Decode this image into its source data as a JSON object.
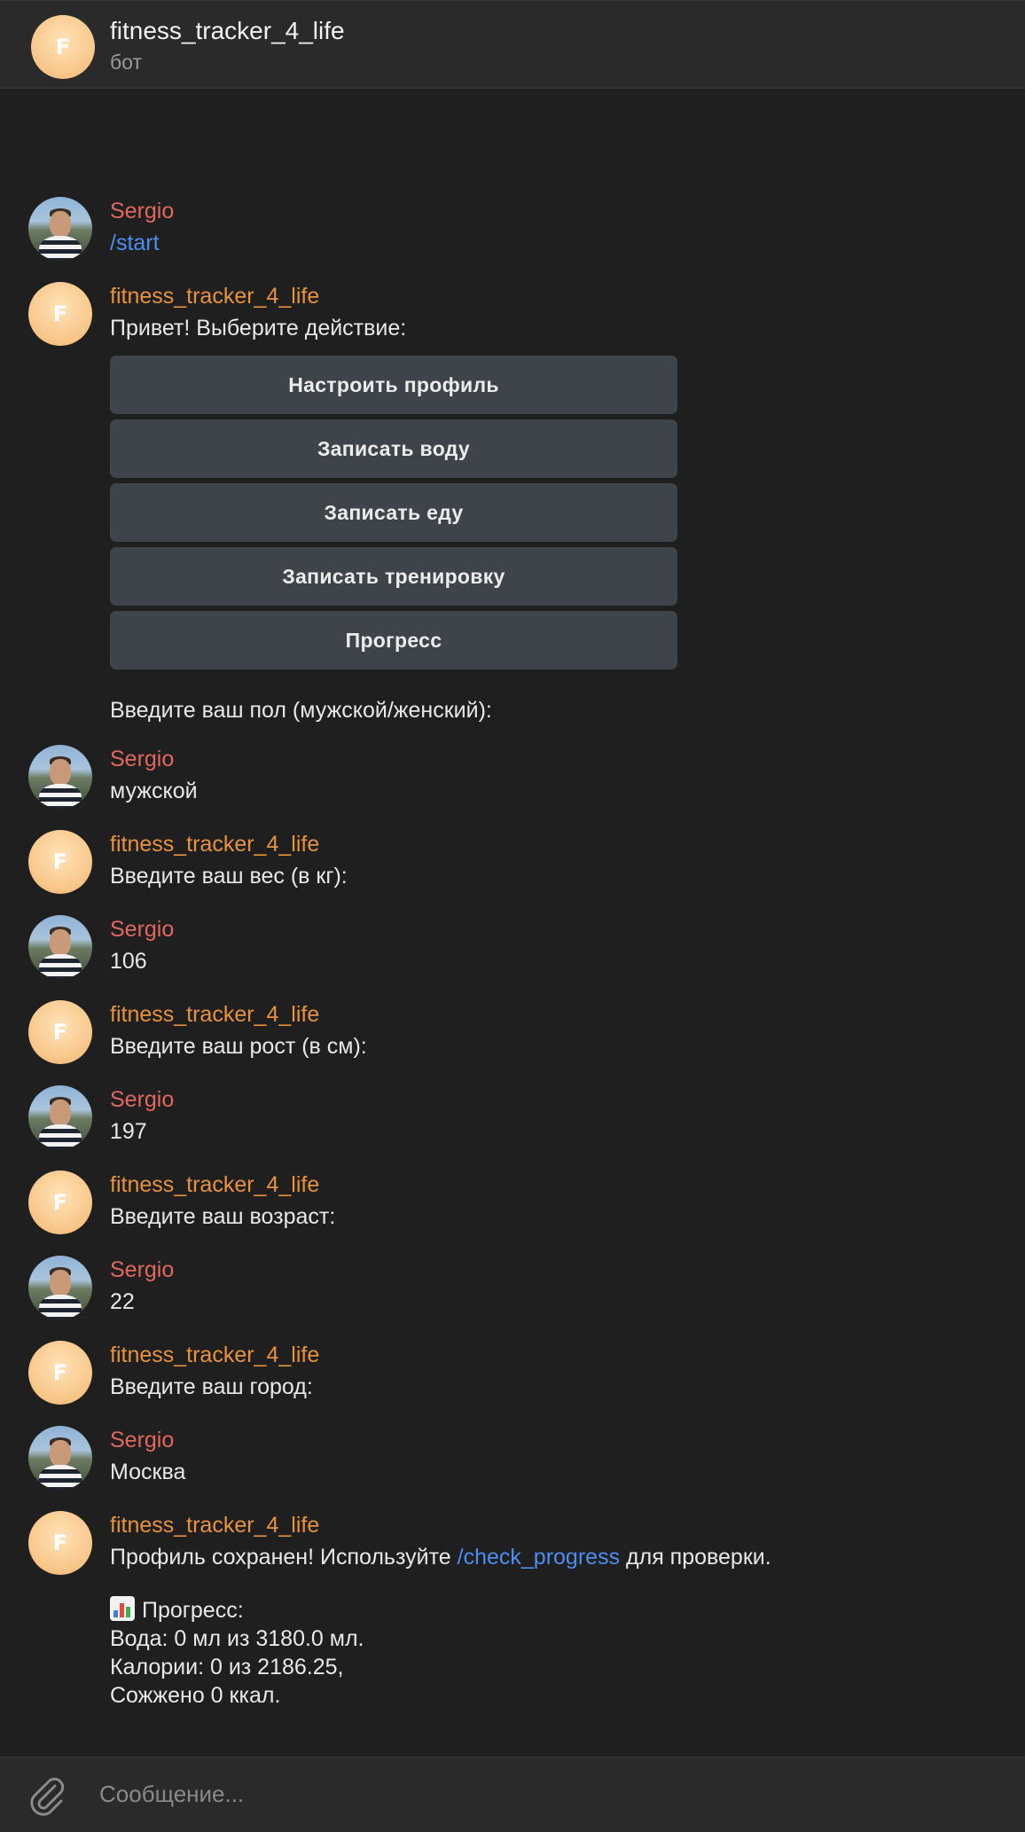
{
  "header": {
    "avatar_letter": "F",
    "title": "fitness_tracker_4_life",
    "subtitle": "бот"
  },
  "messages": [
    {
      "sender": "Sergio",
      "type": "user",
      "text": "/start"
    },
    {
      "sender": "fitness_tracker_4_life",
      "type": "bot",
      "text": "Привет! Выберите действие:"
    },
    {
      "sender": "Sergio",
      "type": "user",
      "text": "мужской"
    },
    {
      "sender": "fitness_tracker_4_life",
      "type": "bot",
      "text": "Введите ваш вес (в кг):"
    },
    {
      "sender": "Sergio",
      "type": "user",
      "text": "106"
    },
    {
      "sender": "fitness_tracker_4_life",
      "type": "bot",
      "text": "Введите ваш рост (в см):"
    },
    {
      "sender": "Sergio",
      "type": "user",
      "text": "197"
    },
    {
      "sender": "fitness_tracker_4_life",
      "type": "bot",
      "text": "Введите ваш возраст:"
    },
    {
      "sender": "Sergio",
      "type": "user",
      "text": "22"
    },
    {
      "sender": "fitness_tracker_4_life",
      "type": "bot",
      "text": "Введите ваш город:"
    },
    {
      "sender": "Sergio",
      "type": "user",
      "text": "Москва"
    },
    {
      "sender": "fitness_tracker_4_life",
      "type": "bot",
      "text_before": "Профиль сохранен! Используйте ",
      "command": "/check_progress",
      "text_after": " для проверки."
    }
  ],
  "keyboard": [
    "Настроить профиль",
    "Записать воду",
    "Записать еду",
    "Записать тренировку",
    "Прогресс"
  ],
  "followup_gender_prompt": "Введите ваш пол (мужской/женский):",
  "progress": {
    "title": "Прогресс:",
    "water": "Вода: 0 мл из 3180.0 мл.",
    "calories": "Калории: 0 из 2186.25,",
    "burned": "Сожжено 0 ккал."
  },
  "composer": {
    "placeholder": "Сообщение..."
  },
  "colors": {
    "user_name": "#e0685c",
    "bot_name": "#e8923a",
    "command_link": "#4c8ef0"
  }
}
